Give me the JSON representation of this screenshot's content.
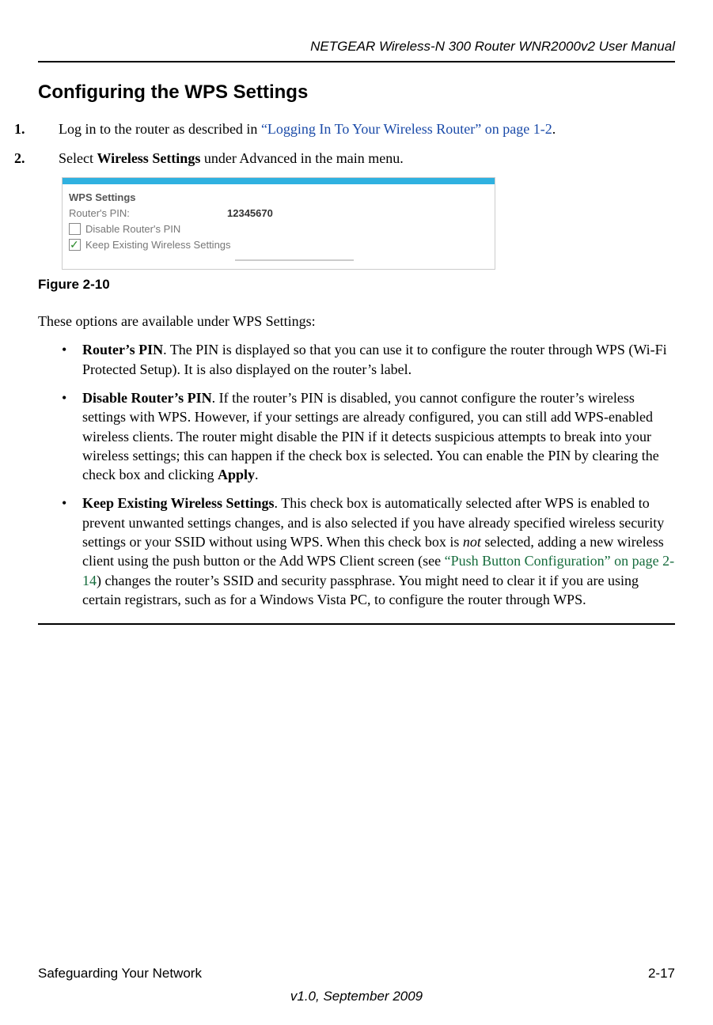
{
  "running_head": "NETGEAR Wireless-N 300 Router WNR2000v2 User Manual",
  "section_title": "Configuring the WPS Settings",
  "steps": {
    "s1_num": "1.",
    "s1_a": "Log in to the router as described in ",
    "s1_link": "“Logging In To Your Wireless Router” on page 1-2",
    "s1_b": ".",
    "s2_num": "2.",
    "s2_a": "Select ",
    "s2_bold": "Wireless Settings",
    "s2_b": " under Advanced in the main menu."
  },
  "figure": {
    "panel_title": "WPS Settings",
    "pin_label": "Router's PIN:",
    "pin_value": "12345670",
    "cb1": "Disable Router's PIN",
    "cb2": "Keep Existing Wireless Settings",
    "caption": "Figure 2-10"
  },
  "lead": "These options are available under WPS Settings:",
  "bullets": {
    "b1_title": "Router’s PIN",
    "b1_body": ". The PIN is displayed so that you can use it to configure the router through WPS (Wi-Fi Protected Setup). It is also displayed on the router’s label.",
    "b2_title": "Disable Router’s PIN",
    "b2_body_a": ". If the router’s PIN is disabled, you cannot configure the router’s wireless settings with WPS. However, if your settings are already configured, you can still add WPS-enabled wireless clients. The router might disable the PIN if it detects suspicious attempts to break into your wireless settings; this can happen if the check box is selected. You can enable the PIN by clearing the check box and clicking ",
    "b2_bold": "Apply",
    "b2_body_b": ".",
    "b3_title": "Keep Existing Wireless Settings",
    "b3_body_a": ". This check box is automatically selected after WPS is enabled to prevent unwanted settings changes, and is also selected if you have already specified wireless security settings or your SSID without using WPS. When this check box is ",
    "b3_em": "not",
    "b3_body_b": " selected, adding a new wireless client using the push button or the Add WPS Client screen (see ",
    "b3_link": "“Push Button Configuration” on page 2-14",
    "b3_body_c": ") changes the router’s SSID and security passphrase. You might need to clear it if you are using certain registrars, such as for a Windows Vista PC, to configure the router through WPS."
  },
  "footer": {
    "left": "Safeguarding Your Network",
    "right": "2-17",
    "version": "v1.0, September 2009"
  }
}
